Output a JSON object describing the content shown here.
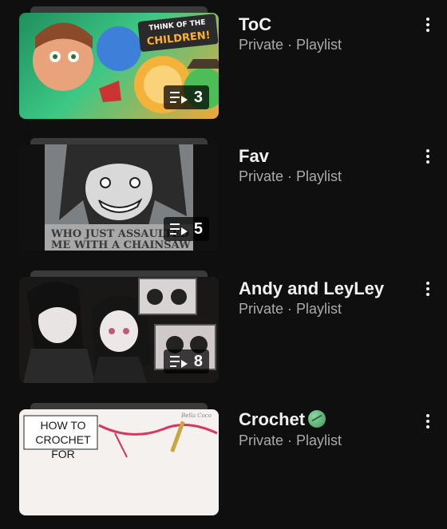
{
  "playlists": [
    {
      "title": "ToC",
      "meta": "Private · Playlist",
      "count": "3",
      "thumb_text": "THINK OF THE CHILDREN!",
      "colors": {
        "bg": "#2fb87a",
        "accent": "#ffb12a"
      }
    },
    {
      "title": "Fav",
      "meta": "Private · Playlist",
      "count": "5",
      "thumb_text": "WHO JUST ASSAULTED ME WITH A CHAINSAW",
      "colors": {
        "bg": "#8d8d8d",
        "accent": "#dcdcdc"
      }
    },
    {
      "title": "Andy and LeyLey",
      "meta": "Private · Playlist",
      "count": "8",
      "thumb_text": "",
      "colors": {
        "bg": "#2a2626",
        "accent": "#cfc9c9"
      }
    },
    {
      "title": "Crochet",
      "meta": "Private · Playlist",
      "count": "",
      "thumb_text": "HOW TO CROCHET FOR",
      "colors": {
        "bg": "#f4f1ee",
        "accent": "#d9355e"
      }
    }
  ],
  "icons": {
    "badge": "playlist-icon",
    "menu": "more-vert-icon",
    "crochet_emoji": "yarn-icon"
  },
  "theme": {
    "background": "#0f0f0f",
    "title_color": "#f1f1f1",
    "meta_color": "#aaaaaa"
  }
}
